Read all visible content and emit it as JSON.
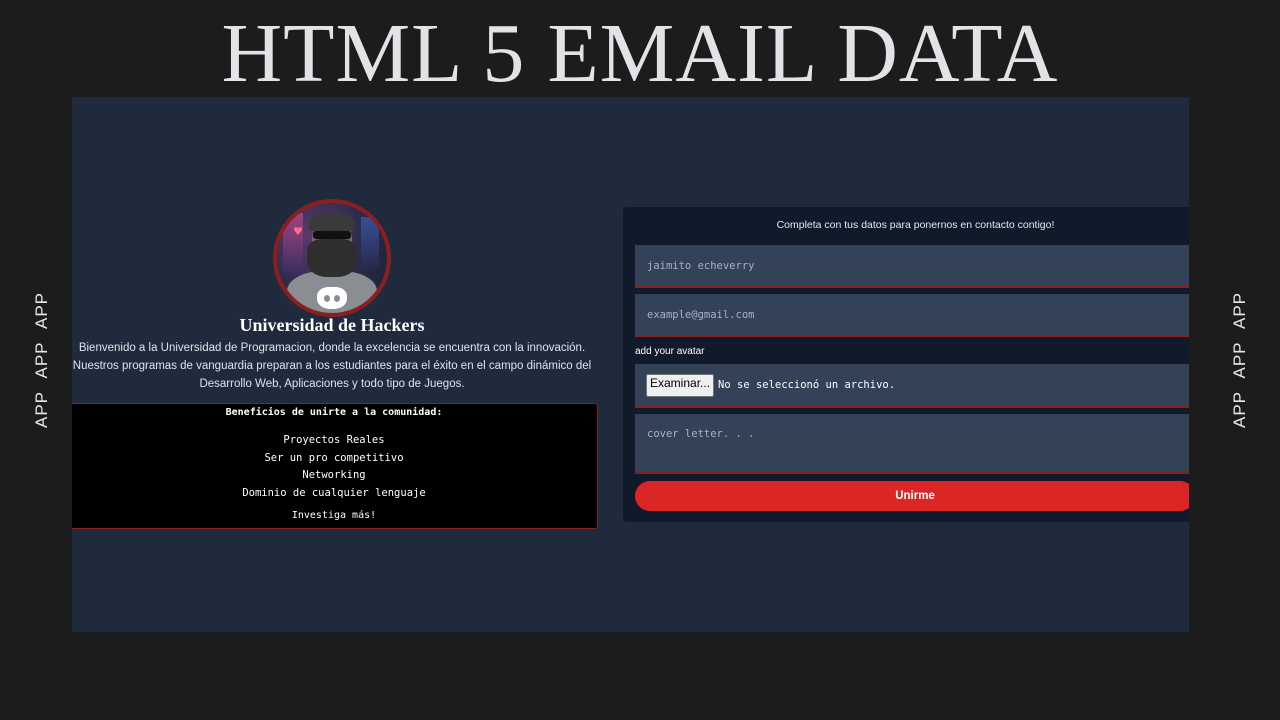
{
  "slide": {
    "title": "HTML 5 EMAIL DATA",
    "side_left": "APP APP APP",
    "side_right": "APP APP APP"
  },
  "profile": {
    "title": "Universidad de Hackers",
    "description": "Bienvenido a la Universidad de Programacion, donde la excelencia se encuentra con la innovación. Nuestros programas de vanguardia preparan a los estudiantes para el éxito en el campo dinámico del Desarrollo Web, Aplicaciones y todo tipo de Juegos."
  },
  "benefits": {
    "title": "Beneficios de unirte a la comunidad:",
    "items": [
      "Proyectos Reales",
      "Ser un pro competitivo",
      "Networking",
      "Dominio de cualquier lenguaje"
    ],
    "more": "Investiga más!"
  },
  "form": {
    "heading": "Completa con tus datos para ponernos en contacto contigo!",
    "name_placeholder": "jaimito echeverry",
    "email_placeholder": "example@gmail.com",
    "avatar_label": "add your avatar",
    "file_button": "Examinar...",
    "file_status": "No se seleccionó un archivo.",
    "cover_placeholder": "cover letter. . .",
    "submit_label": "Unirme"
  },
  "colors": {
    "panel_bg": "#1f2a3c",
    "form_bg": "#111a2a",
    "field_bg": "#334256",
    "accent_red": "#dc2626",
    "border_red": "#8b1e1e"
  }
}
